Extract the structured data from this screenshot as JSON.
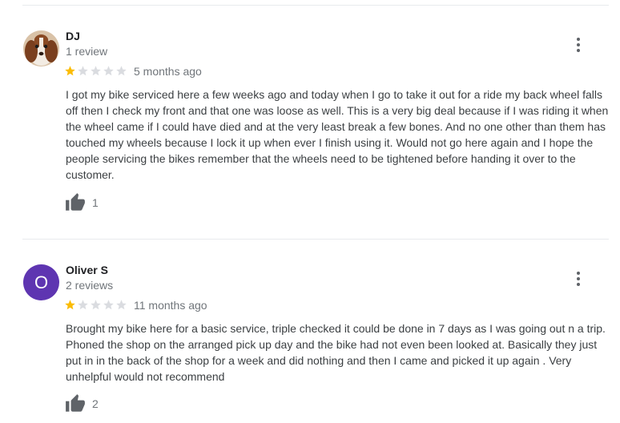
{
  "reviews": [
    {
      "name": "DJ",
      "review_count": "1 review",
      "rating": 1,
      "date": "5 months ago",
      "text": "I got my bike serviced here a few weeks ago and today when I go to take it out for a ride my back wheel falls off then I check my front and that one was loose as well. This is a very big deal because if I was riding it when the wheel came if I could have died and at the very least break a few bones. And no one other than them has touched my wheels because I lock it up when ever I finish using it. Would not go here again and I hope the people servicing the bikes remember that the wheels need to be tightened before handing it over to the customer.",
      "likes": "1",
      "avatar": "dog-photo"
    },
    {
      "name": "Oliver S",
      "review_count": "2 reviews",
      "rating": 1,
      "date": "11 months ago",
      "text": "Brought my bike here for a basic service, triple checked it could be done in 7 days as I was going out n a trip. Phoned the shop on the arranged pick up day and the bike had not even been looked at. Basically they just put in in the back of the shop for a week and  did nothing and then I came and picked it up again . Very unhelpful would not recommend",
      "likes": "2",
      "avatar_initial": "O",
      "avatar_color": "#5e35b1"
    }
  ],
  "colors": {
    "star_filled": "#fbbc04",
    "star_empty": "#dadce0",
    "divider": "#e8eaed"
  }
}
